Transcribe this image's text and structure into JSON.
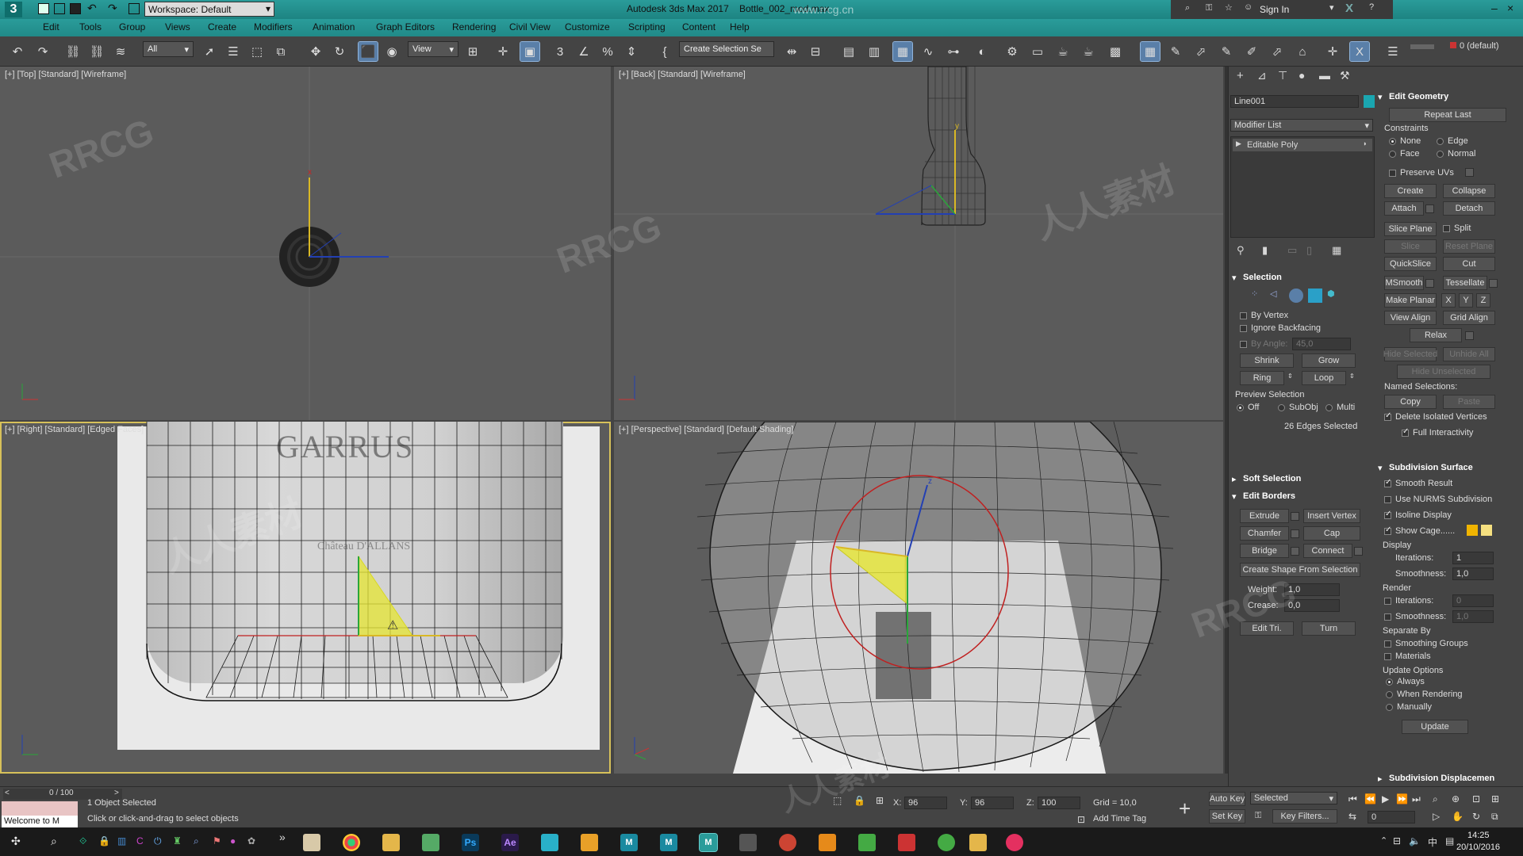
{
  "titlebar": {
    "app_title": "Autodesk 3ds Max 2017",
    "file_name": "Bottle_002_mod.max",
    "workspace_label": "Workspace: Default",
    "sign_in": "Sign In",
    "watermark_url": "www.rrcg.cn",
    "app_logo": "3"
  },
  "menu": [
    "Edit",
    "Tools",
    "Group",
    "Views",
    "Create",
    "Modifiers",
    "Animation",
    "Graph Editors",
    "Rendering",
    "Civil View",
    "Customize",
    "Scripting",
    "Content",
    "Help"
  ],
  "toolbar": {
    "filter_value": "All",
    "refcoord_value": "View",
    "selection_set_placeholder": "Create Selection Se",
    "layer_value": "0 (default)",
    "icons": [
      "undo-icon",
      "redo-icon",
      "link-icon",
      "unlink-icon",
      "bind-spacewarp-icon",
      "select-object-icon",
      "select-by-name-icon",
      "rect-region-icon",
      "window-crossing-icon",
      "move-icon",
      "rotate-icon",
      "scale-icon",
      "select-manipulate-icon",
      "snap-icon",
      "angle-snap-icon",
      "percent-snap-icon",
      "spinner-snap-icon",
      "mirror-icon",
      "align-icon",
      "scene-explorer-icon",
      "layer-explorer-icon",
      "ribbon-icon",
      "curve-editor-icon",
      "schematic-icon",
      "material-editor-icon",
      "render-setup-icon",
      "render-frame-icon",
      "render-icon"
    ]
  },
  "viewports": {
    "top": {
      "label": "[+] [Top] [Standard] [Wireframe]"
    },
    "back": {
      "label": "[+] [Back] [Standard] [Wireframe]"
    },
    "right": {
      "label": "[+] [Right] [Standard] [Edged Faces]",
      "bottle_brand": "GARRUS",
      "bottle_sub": "Château D'ALLANS"
    },
    "perspective": {
      "label": "[+] [Perspective] [Standard] [Default Shading]"
    }
  },
  "modifier_panel": {
    "object_name": "Line001",
    "object_color": "#1aa6b0",
    "modifier_list_label": "Modifier List",
    "stack_item": "Editable Poly"
  },
  "selection_rollout": {
    "title": "Selection",
    "by_vertex": "By Vertex",
    "ignore_backfacing": "Ignore Backfacing",
    "by_angle_label": "By Angle:",
    "by_angle_value": "45,0",
    "shrink": "Shrink",
    "grow": "Grow",
    "ring": "Ring",
    "loop": "Loop",
    "preview_selection": "Preview Selection",
    "preview_off": "Off",
    "preview_subobj": "SubObj",
    "preview_multi": "Multi",
    "edges_selected": "26 Edges Selected"
  },
  "soft_selection": {
    "title": "Soft Selection"
  },
  "edit_borders": {
    "title": "Edit Borders",
    "extrude": "Extrude",
    "insert_vertex": "Insert Vertex",
    "chamfer": "Chamfer",
    "cap": "Cap",
    "bridge": "Bridge",
    "connect": "Connect",
    "create_shape": "Create Shape From Selection",
    "weight_label": "Weight:",
    "weight_value": "1,0",
    "crease_label": "Crease:",
    "crease_value": "0,0",
    "edit_tri": "Edit Tri.",
    "turn": "Turn"
  },
  "edit_geometry": {
    "title": "Edit Geometry",
    "repeat_last": "Repeat Last",
    "constraints": "Constraints",
    "none": "None",
    "edge": "Edge",
    "face": "Face",
    "normal": "Normal",
    "preserve_uvs": "Preserve UVs",
    "create": "Create",
    "collapse": "Collapse",
    "attach": "Attach",
    "detach": "Detach",
    "slice_plane": "Slice Plane",
    "split": "Split",
    "slice": "Slice",
    "reset_plane": "Reset Plane",
    "quickslice": "QuickSlice",
    "cut": "Cut",
    "msmooth": "MSmooth",
    "tessellate": "Tessellate",
    "make_planar": "Make Planar",
    "x": "X",
    "y": "Y",
    "z": "Z",
    "view_align": "View Align",
    "grid_align": "Grid Align",
    "relax": "Relax",
    "hide_selected": "Hide Selected",
    "unhide_all": "Unhide All",
    "hide_unselected": "Hide Unselected",
    "named_selections": "Named Selections:",
    "copy": "Copy",
    "paste": "Paste",
    "delete_isolated": "Delete Isolated Vertices",
    "full_interactivity": "Full Interactivity"
  },
  "subdivision_surface": {
    "title": "Subdivision Surface",
    "smooth_result": "Smooth Result",
    "use_nurms": "Use NURMS Subdivision",
    "isoline": "Isoline Display",
    "show_cage": "Show Cage......",
    "cage_color_1": "#f0b400",
    "cage_color_2": "#f5e080",
    "display": "Display",
    "iterations_label": "Iterations:",
    "display_iterations": "1",
    "smoothness_label": "Smoothness:",
    "display_smoothness": "1,0",
    "render": "Render",
    "render_iterations": "0",
    "render_smoothness": "1,0",
    "separate_by": "Separate By",
    "smoothing_groups": "Smoothing Groups",
    "materials": "Materials",
    "update_options": "Update Options",
    "always": "Always",
    "when_rendering": "When Rendering",
    "manually": "Manually",
    "update": "Update"
  },
  "subdivision_displacement": {
    "title": "Subdivision Displacemen"
  },
  "status": {
    "frame": "0 / 100",
    "objects_selected": "1 Object Selected",
    "prompt": "Click or click-and-drag to select objects",
    "maxscript": "Welcome to M",
    "x_label": "X:",
    "x_value": "96",
    "y_label": "Y:",
    "y_value": "96",
    "z_label": "Z:",
    "z_value": "100",
    "grid": "Grid = 10,0",
    "add_time_tag": "Add Time Tag",
    "auto_key": "Auto Key",
    "set_key": "Set Key",
    "key_mode": "Selected",
    "key_filters": "Key Filters...",
    "current_frame": "0"
  },
  "taskbar": {
    "time": "14:25",
    "date": "20/10/2016",
    "apps": [
      "explorer-icon",
      "chrome-icon",
      "folder-icon",
      "photoshop-icon",
      "aftereffects-icon",
      "3dsmax-icon",
      "maya-icon",
      "file-manager-icon"
    ]
  },
  "watermarks": [
    "RRCG",
    "人人素材"
  ]
}
